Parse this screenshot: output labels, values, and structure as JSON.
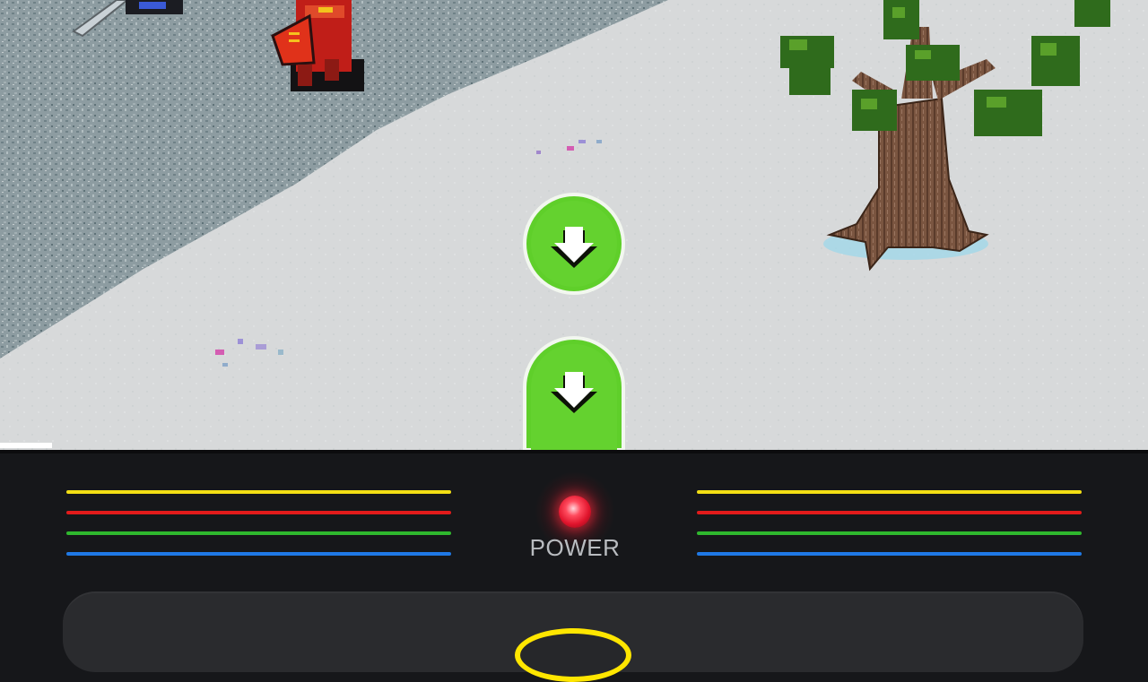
{
  "console": {
    "power_label": "POWER",
    "led_color": "#ff2a3c",
    "stripe_colors": [
      "#f2de14",
      "#e21b1b",
      "#2fb82e",
      "#1f79e6"
    ]
  },
  "controls": {
    "arrow_up_icon": "arrow-down-icon",
    "arrow_down_icon": "arrow-down-icon",
    "button_color": "#5fcf2a",
    "yellow_button_color": "#ffe600"
  },
  "colors": {
    "snow": "#d6d8d9",
    "grass": "#8c9ba0",
    "panel": "#16171a"
  }
}
